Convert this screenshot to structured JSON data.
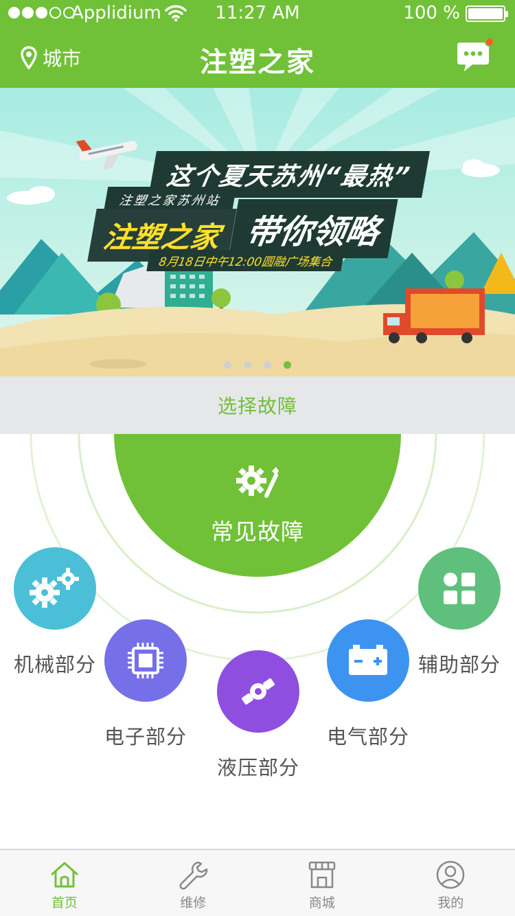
{
  "status_bar": {
    "carrier": "Applidium",
    "time": "11:27 AM",
    "battery": "100 %"
  },
  "navbar": {
    "city_label": "城市",
    "title": "注塑之家",
    "has_unread": true
  },
  "banner": {
    "headline": "这个夏天苏州“最热”",
    "subtitle": "注塑之家苏州站",
    "brand": "注塑之家",
    "slogan": "带你领略",
    "date_line": "8月18日中午12:00圆融广场集合",
    "slide_count": 4,
    "active_slide": 4
  },
  "section": {
    "title": "选择故障"
  },
  "common_fault": {
    "label": "常见故障"
  },
  "categories": [
    {
      "label": "机械部分",
      "color": "#4bbfd8",
      "icon": "gears-icon"
    },
    {
      "label": "电子部分",
      "color": "#7670e8",
      "icon": "chip-icon"
    },
    {
      "label": "液压部分",
      "color": "#8e4fe0",
      "icon": "valve-icon"
    },
    {
      "label": "电气部分",
      "color": "#3d94f0",
      "icon": "battery-icon"
    },
    {
      "label": "辅助部分",
      "color": "#5ec07c",
      "icon": "grid-icon"
    }
  ],
  "tabs": [
    {
      "label": "首页",
      "icon": "home-icon",
      "active": true
    },
    {
      "label": "维修",
      "icon": "wrench-icon",
      "active": false
    },
    {
      "label": "商城",
      "icon": "shop-icon",
      "active": false
    },
    {
      "label": "我的",
      "icon": "user-icon",
      "active": false
    }
  ],
  "colors": {
    "brand_green": "#70c138",
    "section_bg": "#e6e7e9",
    "badge_red": "#ff5a24"
  }
}
